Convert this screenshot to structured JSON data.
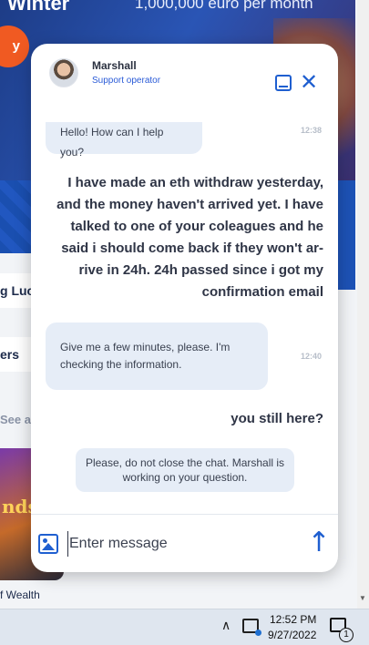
{
  "background": {
    "hero_title": "Winter",
    "hero_subtitle": "1,000,000 euro per month",
    "hero_button": "y",
    "side_items": [
      "g Luck",
      "ers"
    ],
    "see_all": "See a",
    "game_tile_text": "nds",
    "game_name": "f Wealth"
  },
  "chat": {
    "operator": {
      "name": "Marshall",
      "role": "Support operator"
    },
    "messages": [
      {
        "from": "operator",
        "text": "Hello! How can I help you?",
        "time": "12:38"
      },
      {
        "from": "user",
        "lines": [
          "I have made an eth withdraw yesterday,",
          "and the money haven't arrived yet. I have",
          "talked to one of your coleagues and he",
          "said i should come back if they won't ar-",
          "rive in 24h. 24h passed since i got my",
          "confirmation email"
        ]
      },
      {
        "from": "operator",
        "lines": [
          "Give me a few minutes, please. I'm",
          "checking the information."
        ],
        "time": "12:40"
      },
      {
        "from": "user",
        "text": "you still here?"
      }
    ],
    "system_notice": [
      "Please, do not close the chat. Marshall is",
      "working on your question."
    ],
    "input": {
      "placeholder": "Enter message",
      "value": ""
    }
  },
  "taskbar": {
    "time": "12:52 PM",
    "date": "9/27/2022",
    "notification_count": "1"
  },
  "colors": {
    "accent": "#1f5fd0",
    "bubble": "#e6edf7",
    "hero_button": "#f05a22"
  }
}
